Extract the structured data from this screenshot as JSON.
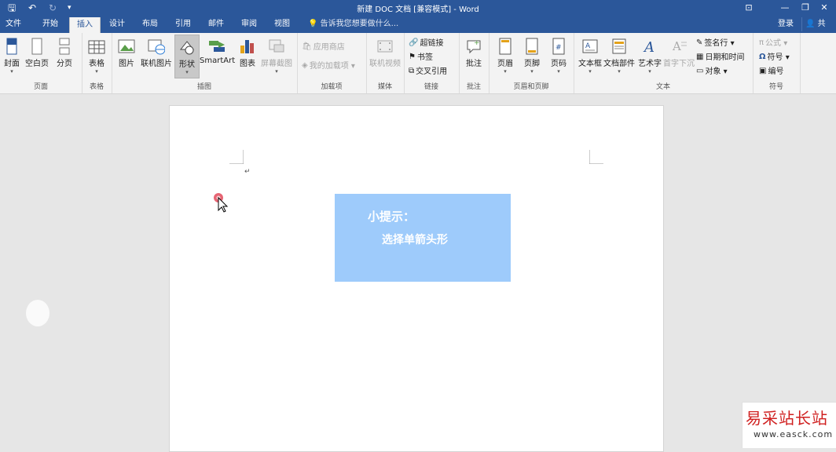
{
  "window": {
    "title": "新建 DOC 文档 [兼容模式] - Word",
    "qa_save": "🖫",
    "qa_undo": "↶",
    "qa_redo": "↻",
    "qa_more": "▾",
    "ribbon_opts": "⊡",
    "minimize": "—",
    "restore": "❐",
    "close": "✕"
  },
  "tabs": [
    "文件",
    "开始",
    "插入",
    "设计",
    "布局",
    "引用",
    "邮件",
    "审阅",
    "视图"
  ],
  "active_tab": "插入",
  "tellme": "告诉我您想要做什么...",
  "login": "登录",
  "share": "共享",
  "ribbon": {
    "pages": {
      "label": "页面",
      "cover": "封面",
      "blank": "空白页",
      "break": "分页"
    },
    "table": {
      "label": "表格",
      "table": "表格"
    },
    "illustrations": {
      "label": "插图",
      "picture": "图片",
      "online_picture": "联机图片",
      "shapes": "形状",
      "smartart": "SmartArt",
      "chart": "图表",
      "screenshot": "屏幕截图"
    },
    "addins": {
      "label": "加载项",
      "store": "应用商店",
      "my_addins": "我的加载项"
    },
    "media": {
      "label": "媒体",
      "online_video": "联机视频"
    },
    "links": {
      "label": "链接",
      "hyperlink": "超链接",
      "bookmark": "书签",
      "cross_ref": "交叉引用"
    },
    "comments": {
      "label": "批注",
      "comment": "批注"
    },
    "header_footer": {
      "label": "页眉和页脚",
      "header": "页眉",
      "footer": "页脚",
      "page_number": "页码"
    },
    "text": {
      "label": "文本",
      "textbox": "文本框",
      "quick_parts": "文档部件",
      "wordart": "艺术字",
      "dropcap": "首字下沉",
      "signature": "签名行",
      "datetime": "日期和时间",
      "object": "对象"
    },
    "symbols": {
      "label": "符号",
      "equation": "公式",
      "symbol": "符号",
      "number": "编号"
    }
  },
  "document": {
    "paragraph_mark": "↵",
    "tip_title": "小提示：",
    "tip_body": "选择单箭头形"
  },
  "colors": {
    "accent": "#2b579a",
    "tip_box": "#9ecbfb"
  },
  "watermark": {
    "name": "易采站长站",
    "url": "www.easck.com"
  }
}
